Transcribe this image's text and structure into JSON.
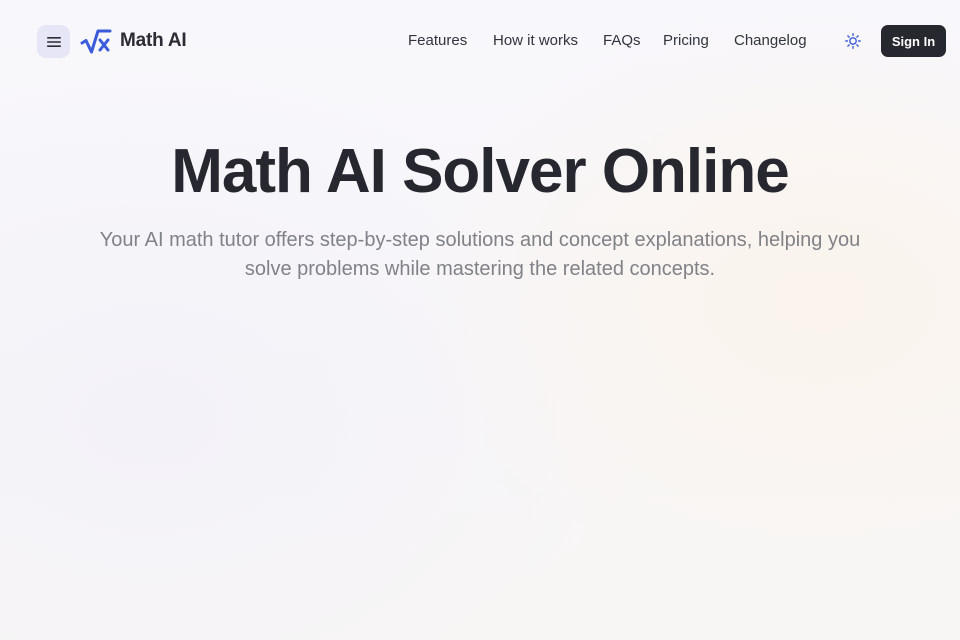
{
  "header": {
    "menu_icon": "hamburger-icon",
    "logo_icon": "square-root-x-icon",
    "logo_text": "Math AI",
    "nav": [
      {
        "label": "Features"
      },
      {
        "label": "How it works"
      },
      {
        "label": "FAQs"
      },
      {
        "label": "Pricing"
      },
      {
        "label": "Changelog"
      }
    ],
    "theme_icon": "sun-icon",
    "signin_label": "Sign In"
  },
  "hero": {
    "title": "Math AI Solver Online",
    "subtitle_line1": "Your AI math tutor offers step-by-step solutions and concept explanations, helping you",
    "subtitle_line2": "solve problems while mastering the related concepts."
  },
  "colors": {
    "accent": "#3b5bdb",
    "menu_bg": "#e7e6f6",
    "dark": "#26272f",
    "muted_text": "#818188"
  }
}
